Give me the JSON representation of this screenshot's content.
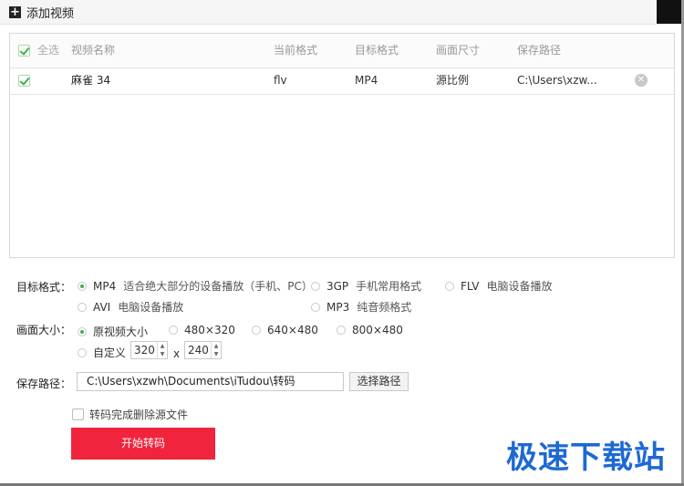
{
  "toolbar": {
    "add_label": "添加视频",
    "add_icon": "plus-icon"
  },
  "table": {
    "headers": {
      "select_all": "全选",
      "name": "视频名称",
      "cur_fmt": "当前格式",
      "target_fmt": "目标格式",
      "size": "画面尺寸",
      "path": "保存路径"
    },
    "rows": [
      {
        "checked": true,
        "name": "麻雀 34",
        "cur_fmt": "flv",
        "target_fmt": "MP4",
        "size": "源比例",
        "path": "C:\\Users\\xzw..."
      }
    ]
  },
  "format": {
    "label": "目标格式：",
    "selected": "MP4",
    "options": [
      {
        "name": "MP4",
        "desc": "适合绝大部分的设备播放（手机、PC）"
      },
      {
        "name": "3GP",
        "desc": "手机常用格式"
      },
      {
        "name": "FLV",
        "desc": "电脑设备播放"
      },
      {
        "name": "AVI",
        "desc": "电脑设备播放"
      },
      {
        "name": "MP3",
        "desc": "纯音频格式"
      }
    ]
  },
  "size": {
    "label": "画面大小：",
    "selected": "原视频大小",
    "options": [
      "原视频大小",
      "480×320",
      "640×480",
      "800×480",
      "自定义"
    ],
    "custom_width": "320",
    "custom_height": "240",
    "times": "x"
  },
  "save": {
    "label": "保存路径：",
    "path": "C:\\Users\\xzwh\\Documents\\iTudou\\转码",
    "choose_button": "选择路径"
  },
  "delete_source_label": "转码完成删除源文件",
  "start_button": "开始转码",
  "watermark": "极速下载站",
  "colors": {
    "accent": "#f0243c",
    "radio_selected": "#43b047",
    "watermark": "#1d69d4"
  }
}
